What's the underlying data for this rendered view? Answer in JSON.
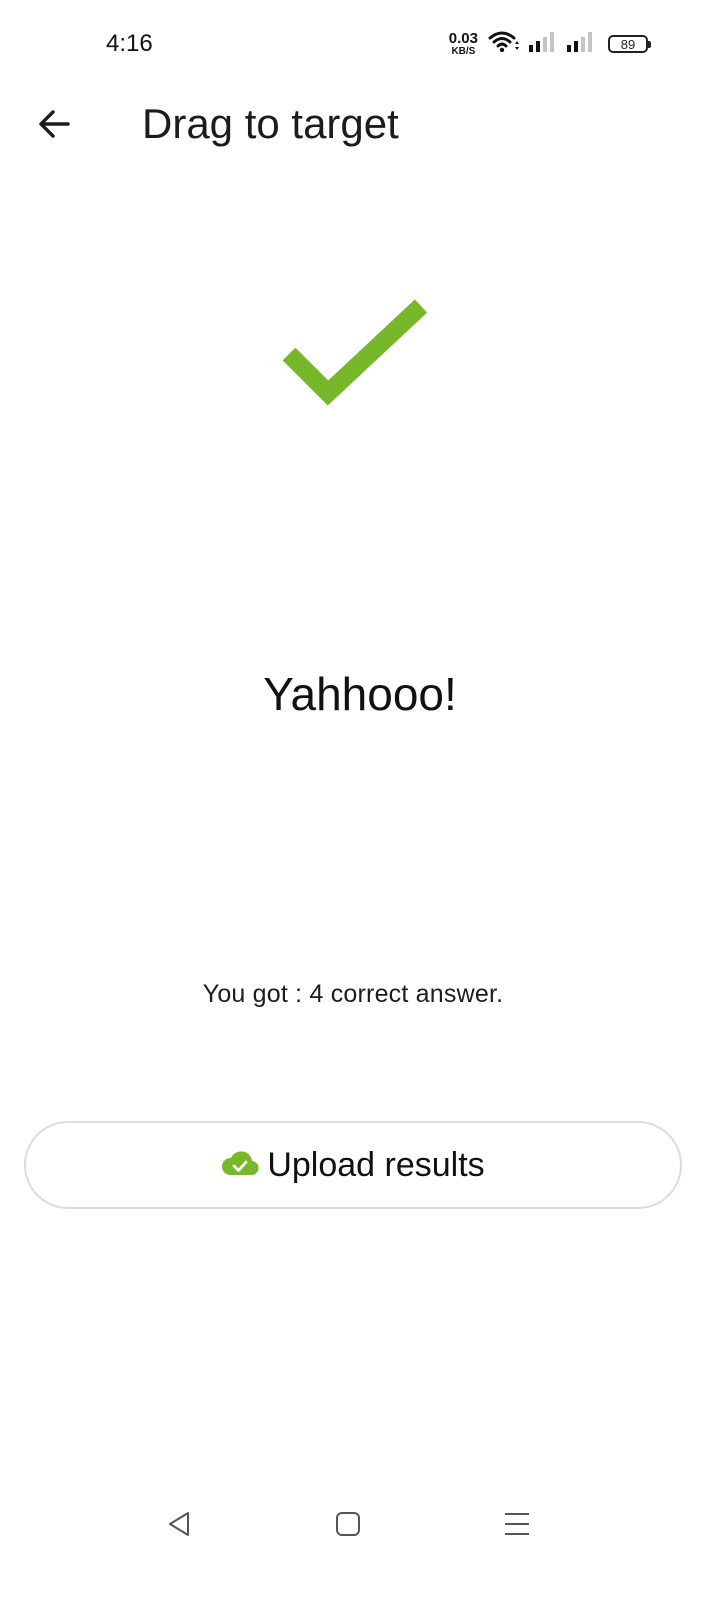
{
  "status_bar": {
    "time": "4:16",
    "net_speed_value": "0.03",
    "net_speed_unit": "KB/S",
    "battery_level": "89",
    "icons": [
      "wifi-icon",
      "signal-icon-1",
      "signal-icon-2",
      "battery-icon"
    ]
  },
  "app_bar": {
    "title": "Drag to target",
    "back_icon": "arrow-back-icon"
  },
  "result": {
    "icon": "checkmark-icon",
    "headline": "Yahhooo!",
    "score_text": "You got : 4 correct answer.",
    "accent_color": "#76b82a"
  },
  "upload": {
    "label": "Upload results",
    "icon": "cloud-check-icon"
  },
  "nav_bar": {
    "icons": [
      "nav-back-icon",
      "nav-home-icon",
      "nav-menu-icon"
    ]
  }
}
